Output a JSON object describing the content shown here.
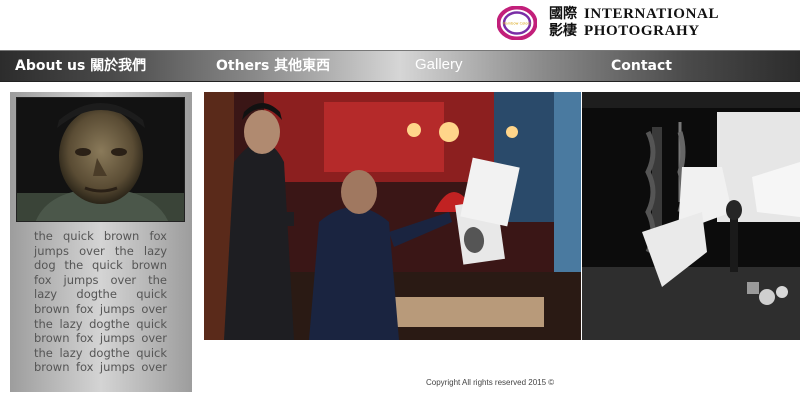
{
  "header": {
    "logo_small_text": "Rainbow Colors",
    "title_cjk_line1": "國際",
    "title_cjk_line2": "影棲",
    "title_en_line1": "INTERNATIONAL",
    "title_en_line2": "PHOTOGRAHY",
    "logo_colors": [
      "#c21f7a",
      "#7a2ea6",
      "#f0c21c"
    ]
  },
  "nav": {
    "about": "About us 關於我們",
    "others": "Others 其他東西",
    "gallery": "Gallery",
    "contact": "Contact"
  },
  "sidebar": {
    "text": "the quick brown fox jumps over the lazy dog the quick brown fox jumps over the lazy dogthe quick brown fox jumps over the lazy dogthe quick brown fox jumps over the lazy dogthe quick brown fox jumps over"
  },
  "footer": {
    "copyright": "Copyright All rights reserved 2015 ©"
  }
}
